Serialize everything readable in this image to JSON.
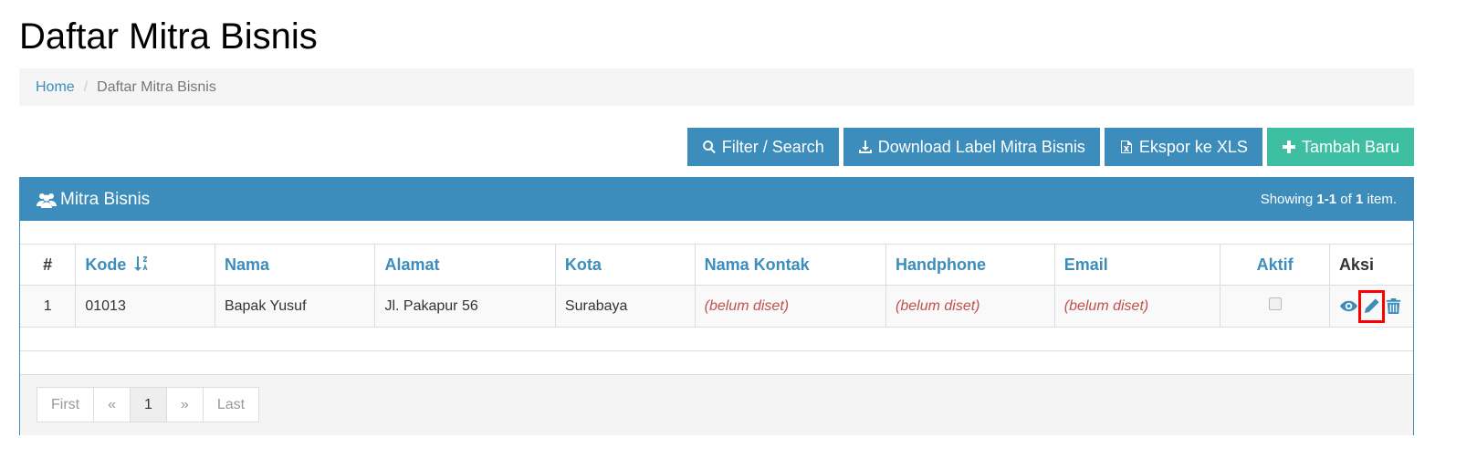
{
  "page": {
    "title": "Daftar Mitra Bisnis"
  },
  "breadcrumb": {
    "home": "Home",
    "current": "Daftar Mitra Bisnis"
  },
  "toolbar": {
    "filter_label": "Filter / Search",
    "download_label": "Download Label Mitra Bisnis",
    "export_label": "Ekspor ke XLS",
    "add_label": "Tambah Baru"
  },
  "panel": {
    "title": "Mitra Bisnis",
    "summary_prefix": "Showing ",
    "summary_range": "1-1",
    "summary_mid": " of ",
    "summary_total": "1",
    "summary_suffix": " item."
  },
  "table": {
    "headers": [
      "#",
      "Kode",
      "Nama",
      "Alamat",
      "Kota",
      "Nama Kontak",
      "Handphone",
      "Email",
      "Aktif",
      "Aksi"
    ],
    "rows": [
      {
        "no": "1",
        "kode": "01013",
        "nama": "Bapak Yusuf",
        "alamat": "Jl. Pakapur 56",
        "kota": "Surabaya",
        "nama_kontak": "(belum diset)",
        "handphone": "(belum diset)",
        "email": "(belum diset)",
        "aktif": false
      }
    ]
  },
  "pager": {
    "first": "First",
    "prev": "«",
    "page": "1",
    "next": "»",
    "last": "Last"
  },
  "colors": {
    "primary": "#3c8dbc",
    "success": "#3ebfa1",
    "empty_value": "#c0504d",
    "highlight": "#ff0000"
  }
}
